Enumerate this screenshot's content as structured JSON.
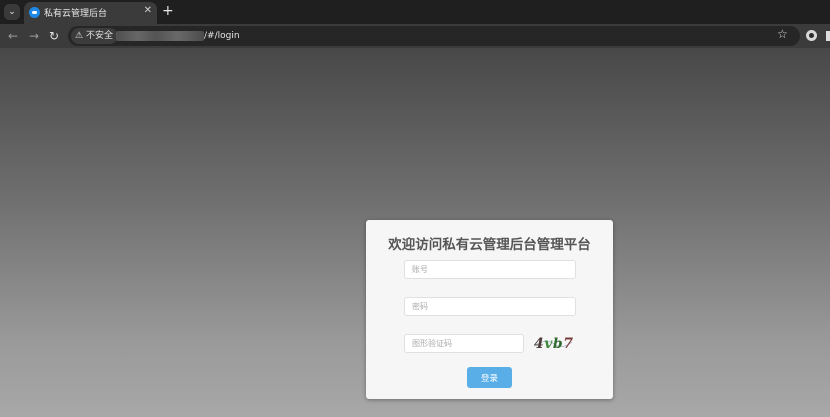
{
  "browser": {
    "tab_title": "私有云管理后台",
    "tab_close": "✕",
    "new_tab": "+",
    "menu_glyph": "⌄",
    "back": "←",
    "forward": "→",
    "reload": "↻",
    "security_label": "不安全",
    "url_path": "/#/login",
    "bookmark_glyph": "☆"
  },
  "login": {
    "title": "欢迎访问私有云管理后台管理平台",
    "account_placeholder": "账号",
    "password_placeholder": "密码",
    "captcha_placeholder": "图形验证码",
    "captcha_text": "4vb7",
    "submit_label": "登录"
  },
  "colors": {
    "button": "#5aaee8",
    "card": "#f6f6f6",
    "captcha_chars": [
      "#4a3a3a",
      "#3f8a3f",
      "#2f6a2f",
      "#7a3a3a"
    ]
  }
}
